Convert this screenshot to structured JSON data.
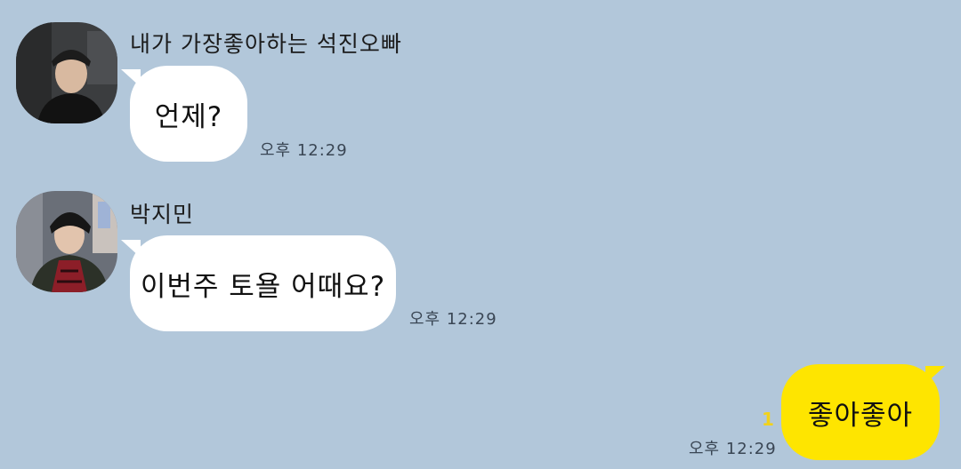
{
  "messages": [
    {
      "sender": "내가 가장좋아하는 석진오빠",
      "text": "언제?",
      "time": "오후 12:29"
    },
    {
      "sender": "박지민",
      "text": "이번주 토욜 어때요?",
      "time": "오후 12:29"
    },
    {
      "text": "좋아좋아",
      "time": "오후 12:29",
      "read_mark": "1"
    }
  ],
  "colors": {
    "background": "#b2c7da",
    "incoming_bubble": "#ffffff",
    "outgoing_bubble": "#fee500"
  }
}
